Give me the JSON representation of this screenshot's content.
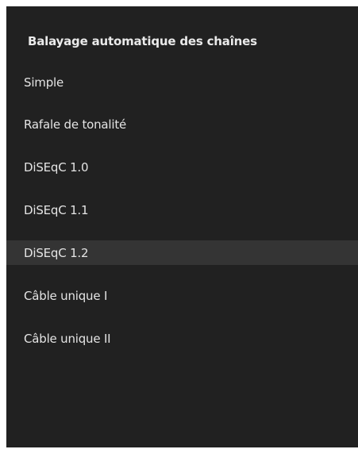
{
  "menu": {
    "title": "Balayage automatique des chaînes",
    "selected_index": 4,
    "items": [
      {
        "label": "Simple"
      },
      {
        "label": "Rafale de tonalité"
      },
      {
        "label": "DiSEqC 1.0"
      },
      {
        "label": "DiSEqC 1.1"
      },
      {
        "label": "DiSEqC 1.2"
      },
      {
        "label": "Câble unique I"
      },
      {
        "label": "Câble unique II"
      }
    ]
  },
  "colors": {
    "panel_background": "#212121",
    "selected_background": "#343434",
    "text": "#e4e4e4"
  }
}
